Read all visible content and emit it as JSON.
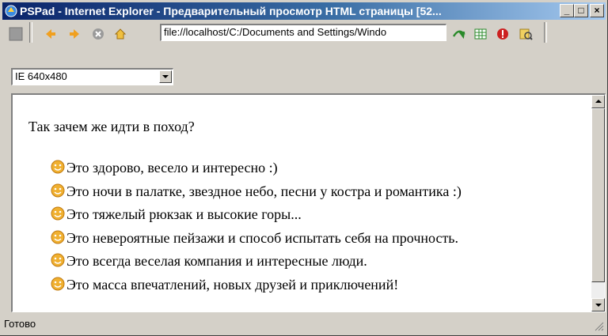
{
  "window": {
    "title": "PSPad - Internet Explorer - Предварительный просмотр HTML страницы  [52...",
    "buttons": {
      "minimize": "_",
      "maximize": "□",
      "close": "×"
    }
  },
  "toolbar": {
    "address": "file://localhost/C:/Documents and Settings/Windo",
    "icons": [
      "stop-icon",
      "back-icon",
      "forward-icon",
      "refresh-icon",
      "home-icon",
      "go-icon",
      "grid-icon",
      "alert-icon",
      "search-icon"
    ]
  },
  "size_select": {
    "value": "IE 640x480"
  },
  "content": {
    "heading": "Так зачем же идти в поход?",
    "items": [
      "Это здорово, весело и интересно :)",
      "Это ночи в палатке, звездное небо, песни у костра и романтика :)",
      "Это тяжелый рюкзак и высокие горы...",
      "Это невероятные пейзажи и способ испытать себя на прочность.",
      "Это всегда веселая компания и интересные люди.",
      "Это масса впечатлений, новых друзей и приключений!"
    ]
  },
  "status": {
    "text": "Готово"
  },
  "colors": {
    "titlebar_start": "#0a246a",
    "titlebar_end": "#a6caf0",
    "smiley": "#f0b030"
  }
}
